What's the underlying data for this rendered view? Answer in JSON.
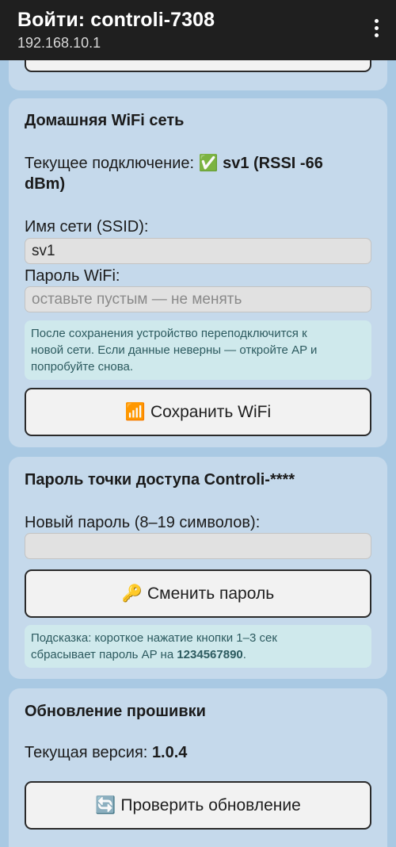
{
  "topbar": {
    "title": "Войти: controli-7308",
    "url": "192.168.10.1"
  },
  "wifi": {
    "heading": "Домашняя WiFi сеть",
    "current_label": "Текущее подключение:",
    "current_icon": "✅",
    "current_value_1": "sv1 (RSSI -66",
    "current_value_2": "dBm)",
    "ssid_label": "Имя сети (SSID):",
    "ssid_value": "sv1",
    "password_label": "Пароль WiFi:",
    "password_placeholder": "оставьте пустым — не менять",
    "note_line1": "После сохранения устройство переподключится к",
    "note_line2": "новой сети. Если данные неверны — откройте AP и",
    "note_line3": "попробуйте снова.",
    "save_icon": "📶",
    "save_label": "Сохранить WiFi"
  },
  "ap": {
    "heading": "Пароль точки доступа Controli-****",
    "new_password_label": "Новый пароль (8–19 символов):",
    "change_icon": "🔑",
    "change_label": "Сменить пароль",
    "hint_line1": "Подсказка: короткое нажатие кнопки 1–3 сек",
    "hint_line2_prefix": "сбрасывает пароль AP на",
    "hint_password": "1234567890",
    "hint_suffix": "."
  },
  "firmware": {
    "heading": "Обновление прошивки",
    "version_label": "Текущая версия:",
    "version_value": "1.0.4",
    "check_icon": "🔄",
    "check_label": "Проверить обновление"
  },
  "colors": {
    "page_bg": "#a9c9e3",
    "card_bg": "#c5d9eb",
    "note_bg": "#cfe9ec",
    "topbar_bg": "#1f1f1f"
  }
}
